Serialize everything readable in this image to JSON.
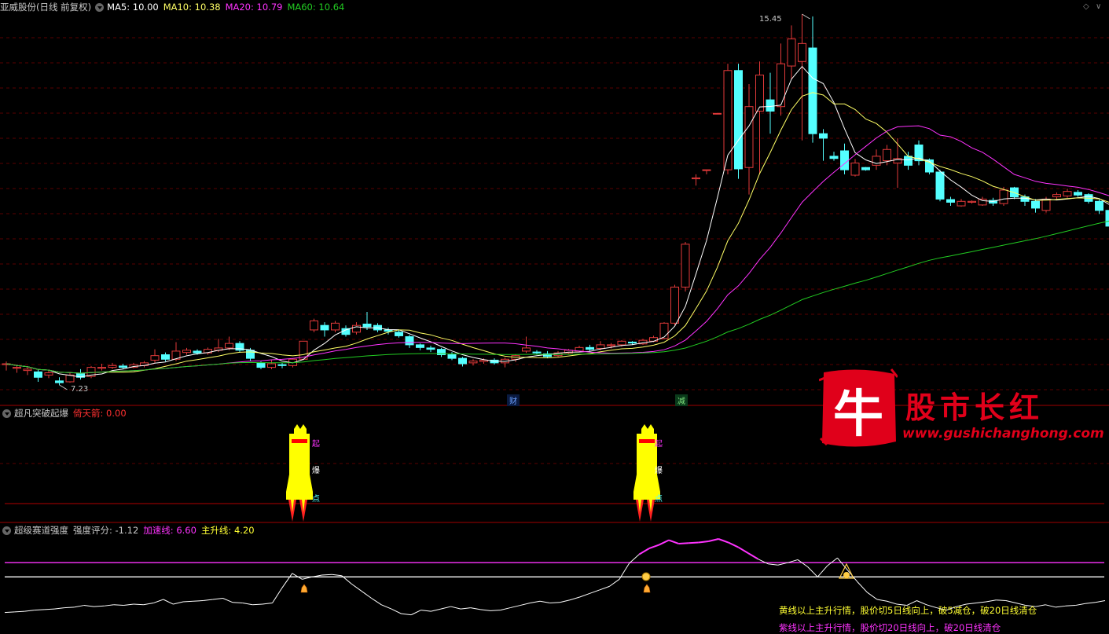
{
  "main_header": {
    "title": "亚威股份(日线 前复权)",
    "ma5": "MA5: 10.00",
    "ma10": "MA10: 10.38",
    "ma20": "MA20: 10.79",
    "ma60": "MA60: 10.64"
  },
  "annotations": {
    "high": "15.45",
    "low": "7.23",
    "tag_cai": "财",
    "tag_jian": "减"
  },
  "panel2": {
    "title": "超凡突破起爆",
    "metric": "倚天箭: 0.00",
    "rocket_labels": {
      "qi": "起",
      "bao": "爆",
      "dian": "点"
    }
  },
  "panel3": {
    "title": "超级赛道强度",
    "score": "强度评分: -1.12",
    "accel": "加速线: 6.60",
    "main": "主升线: 4.20",
    "note_yellow": "黄线以上主升行情，股价切5日线向上，破5减仓，破20日线清仓",
    "note_purple": "紫线以上主升行情，股价切20日线向上，破20日线清仓"
  },
  "brand": {
    "logo_char": "牛",
    "name": "股市长红",
    "url": "www.gushichanghong.com"
  },
  "colors": {
    "up": "#e23a3a",
    "down": "#54ffff",
    "ma5": "#ffffff",
    "ma10": "#ffff66",
    "ma20": "#ff33ff",
    "ma60": "#22cc22",
    "accent_red": "#e0001a"
  },
  "chart_data": {
    "type": "candlestick",
    "price_range": [
      7.23,
      15.45
    ],
    "candles": [
      [
        7.68,
        7.7,
        7.55,
        7.75
      ],
      [
        7.6,
        7.62,
        7.5,
        7.68
      ],
      [
        7.55,
        7.58,
        7.45,
        7.62
      ],
      [
        7.52,
        7.4,
        7.3,
        7.56
      ],
      [
        7.45,
        7.5,
        7.38,
        7.55
      ],
      [
        7.32,
        7.28,
        7.23,
        7.4
      ],
      [
        7.3,
        7.45,
        7.28,
        7.5
      ],
      [
        7.48,
        7.4,
        7.35,
        7.58
      ],
      [
        7.42,
        7.62,
        7.38,
        7.65
      ],
      [
        7.6,
        7.62,
        7.55,
        7.7
      ],
      [
        7.62,
        7.66,
        7.58,
        7.72
      ],
      [
        7.65,
        7.62,
        7.58,
        7.7
      ],
      [
        7.62,
        7.68,
        7.6,
        7.72
      ],
      [
        7.66,
        7.72,
        7.62,
        7.76
      ],
      [
        7.78,
        7.88,
        7.72,
        8.02
      ],
      [
        7.9,
        7.8,
        7.75,
        7.95
      ],
      [
        7.8,
        7.98,
        7.76,
        8.18
      ],
      [
        7.95,
        8.0,
        7.9,
        8.05
      ],
      [
        7.98,
        7.94,
        7.9,
        8.02
      ],
      [
        7.94,
        8.02,
        7.9,
        8.06
      ],
      [
        8.0,
        8.05,
        7.96,
        8.25
      ],
      [
        8.05,
        8.15,
        8.0,
        8.3
      ],
      [
        8.15,
        8.0,
        7.95,
        8.2
      ],
      [
        8.0,
        7.82,
        7.76,
        8.05
      ],
      [
        7.72,
        7.62,
        7.58,
        7.75
      ],
      [
        7.62,
        7.7,
        7.58,
        7.78
      ],
      [
        7.68,
        7.66,
        7.6,
        7.72
      ],
      [
        7.66,
        7.8,
        7.62,
        7.82
      ],
      [
        7.8,
        8.2,
        7.78,
        8.2
      ],
      [
        8.45,
        8.65,
        8.4,
        8.7
      ],
      [
        8.55,
        8.45,
        8.3,
        8.62
      ],
      [
        8.45,
        8.6,
        8.4,
        8.65
      ],
      [
        8.48,
        8.35,
        8.3,
        8.55
      ],
      [
        8.4,
        8.55,
        8.35,
        8.62
      ],
      [
        8.58,
        8.52,
        8.45,
        8.85
      ],
      [
        8.55,
        8.45,
        8.4,
        8.6
      ],
      [
        8.45,
        8.42,
        8.35,
        8.5
      ],
      [
        8.4,
        8.32,
        8.28,
        8.44
      ],
      [
        8.3,
        8.12,
        8.05,
        8.34
      ],
      [
        8.12,
        8.06,
        8.0,
        8.15
      ],
      [
        8.05,
        8.02,
        7.96,
        8.1
      ],
      [
        8.02,
        7.9,
        7.85,
        8.05
      ],
      [
        7.9,
        7.82,
        7.78,
        7.96
      ],
      [
        7.82,
        7.7,
        7.64,
        7.85
      ],
      [
        7.72,
        7.76,
        7.66,
        7.8
      ],
      [
        7.75,
        7.78,
        7.7,
        7.82
      ],
      [
        7.78,
        7.72,
        7.68,
        7.82
      ],
      [
        7.72,
        7.8,
        7.62,
        7.84
      ],
      [
        7.8,
        7.88,
        7.74,
        7.9
      ],
      [
        7.98,
        8.05,
        7.94,
        8.3
      ],
      [
        7.96,
        7.94,
        7.9,
        8.0
      ],
      [
        7.92,
        7.86,
        7.82,
        7.98
      ],
      [
        7.88,
        7.94,
        7.84,
        7.98
      ],
      [
        7.94,
        8.0,
        7.92,
        8.03
      ],
      [
        7.98,
        8.06,
        7.96,
        8.1
      ],
      [
        8.06,
        8.02,
        7.98,
        8.12
      ],
      [
        8.04,
        8.12,
        8.0,
        8.2
      ],
      [
        8.1,
        8.12,
        8.04,
        8.16
      ],
      [
        8.12,
        8.2,
        8.08,
        8.22
      ],
      [
        8.18,
        8.16,
        8.12,
        8.2
      ],
      [
        8.14,
        8.22,
        8.12,
        8.25
      ],
      [
        8.2,
        8.28,
        8.18,
        8.32
      ],
      [
        8.26,
        8.6,
        8.24,
        8.62
      ],
      [
        8.6,
        9.4,
        8.55,
        9.45
      ],
      [
        9.4,
        10.35,
        9.3,
        10.4
      ],
      [
        11.8,
        11.82,
        11.65,
        11.9
      ],
      [
        12.0,
        12.0,
        11.9,
        12.0
      ],
      [
        13.25,
        13.25,
        13.25,
        13.25
      ],
      [
        12.0,
        14.2,
        11.9,
        14.35
      ],
      [
        14.2,
        12.02,
        11.8,
        14.35
      ],
      [
        12.05,
        13.4,
        11.45,
        13.9
      ],
      [
        13.3,
        14.1,
        11.9,
        14.4
      ],
      [
        13.55,
        13.3,
        12.8,
        14.15
      ],
      [
        13.4,
        14.35,
        13.2,
        14.8
      ],
      [
        14.3,
        14.9,
        14.0,
        15.2
      ],
      [
        14.4,
        14.8,
        12.65,
        15.45
      ],
      [
        14.7,
        12.8,
        12.6,
        15.4
      ],
      [
        12.8,
        12.7,
        12.2,
        12.9
      ],
      [
        12.3,
        12.25,
        12.2,
        12.4
      ],
      [
        12.42,
        12.0,
        11.9,
        12.58
      ],
      [
        11.88,
        12.15,
        11.85,
        12.24
      ],
      [
        12.05,
        12.0,
        11.98,
        12.06
      ],
      [
        12.1,
        12.3,
        12.0,
        12.45
      ],
      [
        12.2,
        12.45,
        12.1,
        12.55
      ],
      [
        12.15,
        12.25,
        11.6,
        12.7
      ],
      [
        12.3,
        12.1,
        12.0,
        12.4
      ],
      [
        12.55,
        12.2,
        12.1,
        12.65
      ],
      [
        12.22,
        11.95,
        11.9,
        12.25
      ],
      [
        11.95,
        11.35,
        11.3,
        12.0
      ],
      [
        11.34,
        11.28,
        11.2,
        11.4
      ],
      [
        11.2,
        11.3,
        11.18,
        11.35
      ],
      [
        11.28,
        11.3,
        11.25,
        11.32
      ],
      [
        11.22,
        11.35,
        11.2,
        11.4
      ],
      [
        11.32,
        11.26,
        11.2,
        11.38
      ],
      [
        11.25,
        11.55,
        11.2,
        11.62
      ],
      [
        11.6,
        11.4,
        11.35,
        11.62
      ],
      [
        11.4,
        11.3,
        11.2,
        11.45
      ],
      [
        11.3,
        11.15,
        11.05,
        11.35
      ],
      [
        11.1,
        11.35,
        11.05,
        11.4
      ],
      [
        11.4,
        11.45,
        11.35,
        11.5
      ],
      [
        11.42,
        11.52,
        11.38,
        11.58
      ],
      [
        11.5,
        11.44,
        11.4,
        11.55
      ],
      [
        11.45,
        11.3,
        11.25,
        11.48
      ],
      [
        11.3,
        11.1,
        11.02,
        11.34
      ],
      [
        11.1,
        10.75,
        10.7,
        11.12
      ],
      [
        10.6,
        10.45,
        10.4,
        10.62
      ],
      [
        10.44,
        10.55,
        10.4,
        10.65
      ],
      [
        10.55,
        10.35,
        10.3,
        10.58
      ],
      [
        10.35,
        10.4,
        10.3,
        10.45
      ],
      [
        10.42,
        10.3,
        10.25,
        10.45
      ],
      [
        10.28,
        10.25,
        10.18,
        10.3
      ]
    ],
    "series": [
      {
        "name": "MA5"
      },
      {
        "name": "MA10"
      },
      {
        "name": "MA20"
      },
      {
        "name": "MA60"
      }
    ],
    "strength_values": [
      -1.8,
      -1.7,
      -1.6,
      -1.4,
      -1.3,
      -1.2,
      -1.0,
      -0.9,
      -0.6,
      -0.8,
      -0.7,
      -0.5,
      -0.6,
      -0.4,
      -0.5,
      -0.2,
      0.4,
      -0.4,
      0.0,
      0.1,
      0.2,
      0.4,
      0.6,
      -0.1,
      -0.2,
      -0.5,
      -0.4,
      -0.2,
      2.4,
      4.8,
      3.8,
      4.2,
      4.5,
      4.6,
      4.4,
      3.0,
      1.8,
      0.6,
      -0.5,
      -1.2,
      -2.0,
      -2.2,
      -1.4,
      -1.6,
      -1.2,
      -0.8,
      -1.2,
      -1.0,
      -1.3,
      -1.5,
      -1.4,
      -1.0,
      -0.6,
      -0.2,
      0.1,
      -0.2,
      -0.1,
      0.3,
      0.8,
      1.4,
      2.0,
      2.6,
      3.8,
      6.5,
      8.0,
      9.0,
      9.6,
      10.4,
      9.8,
      9.9,
      10.0,
      10.2,
      10.6,
      10.0,
      9.2,
      8.2,
      7.2,
      6.4,
      6.2,
      6.6,
      7.1,
      5.9,
      4.2,
      6.1,
      7.4,
      5.4,
      3.4,
      1.6,
      0.4,
      0.1,
      -0.4,
      -0.6,
      0.2,
      -0.5,
      -1.0,
      -1.4,
      -0.8,
      -0.4,
      -0.2,
      0.0,
      0.3,
      0.2,
      -0.2,
      -0.6,
      -0.8,
      -0.5,
      -0.9,
      -0.7,
      -0.6,
      -0.3,
      -0.1,
      0.2
    ],
    "accel_line": 6.6,
    "main_line": 4.2
  }
}
